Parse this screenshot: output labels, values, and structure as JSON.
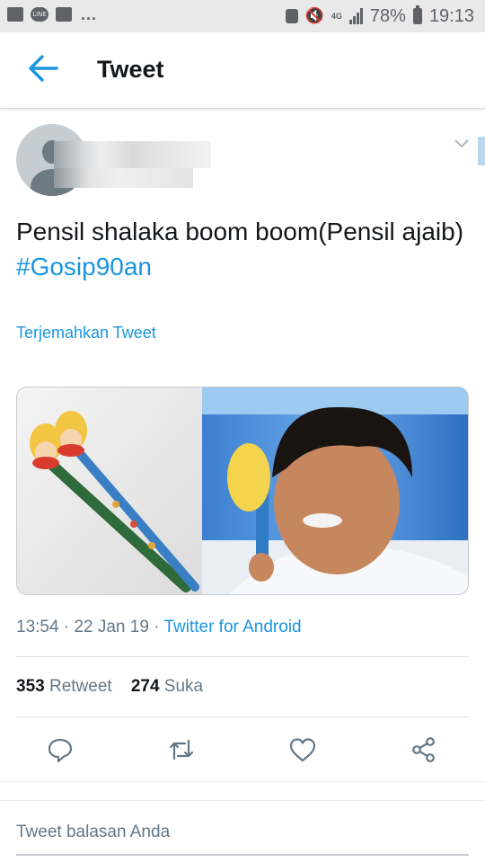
{
  "status_bar": {
    "line_badge": "LINE",
    "dots": "...",
    "network": "4G",
    "battery_pct": "78%",
    "time": "19:13"
  },
  "header": {
    "title": "Tweet"
  },
  "tweet": {
    "text": "Pensil shalaka boom boom(Pensil ajaib)",
    "hashtag": "#Gosip90an",
    "translate_label": "Terjemahkan Tweet",
    "time": "13:54",
    "date": "22 Jan 19",
    "source": "Twitter for Android",
    "retweet_count": "353",
    "retweet_label": "Retweet",
    "like_count": "274",
    "like_label": "Suka"
  },
  "actions": [
    "reply-icon",
    "retweet-icon",
    "like-icon",
    "share-icon"
  ],
  "reply_box": {
    "placeholder": "Tweet balasan Anda"
  },
  "colors": {
    "accent": "#1b95e0",
    "text": "#14171a",
    "muted": "#657786"
  }
}
